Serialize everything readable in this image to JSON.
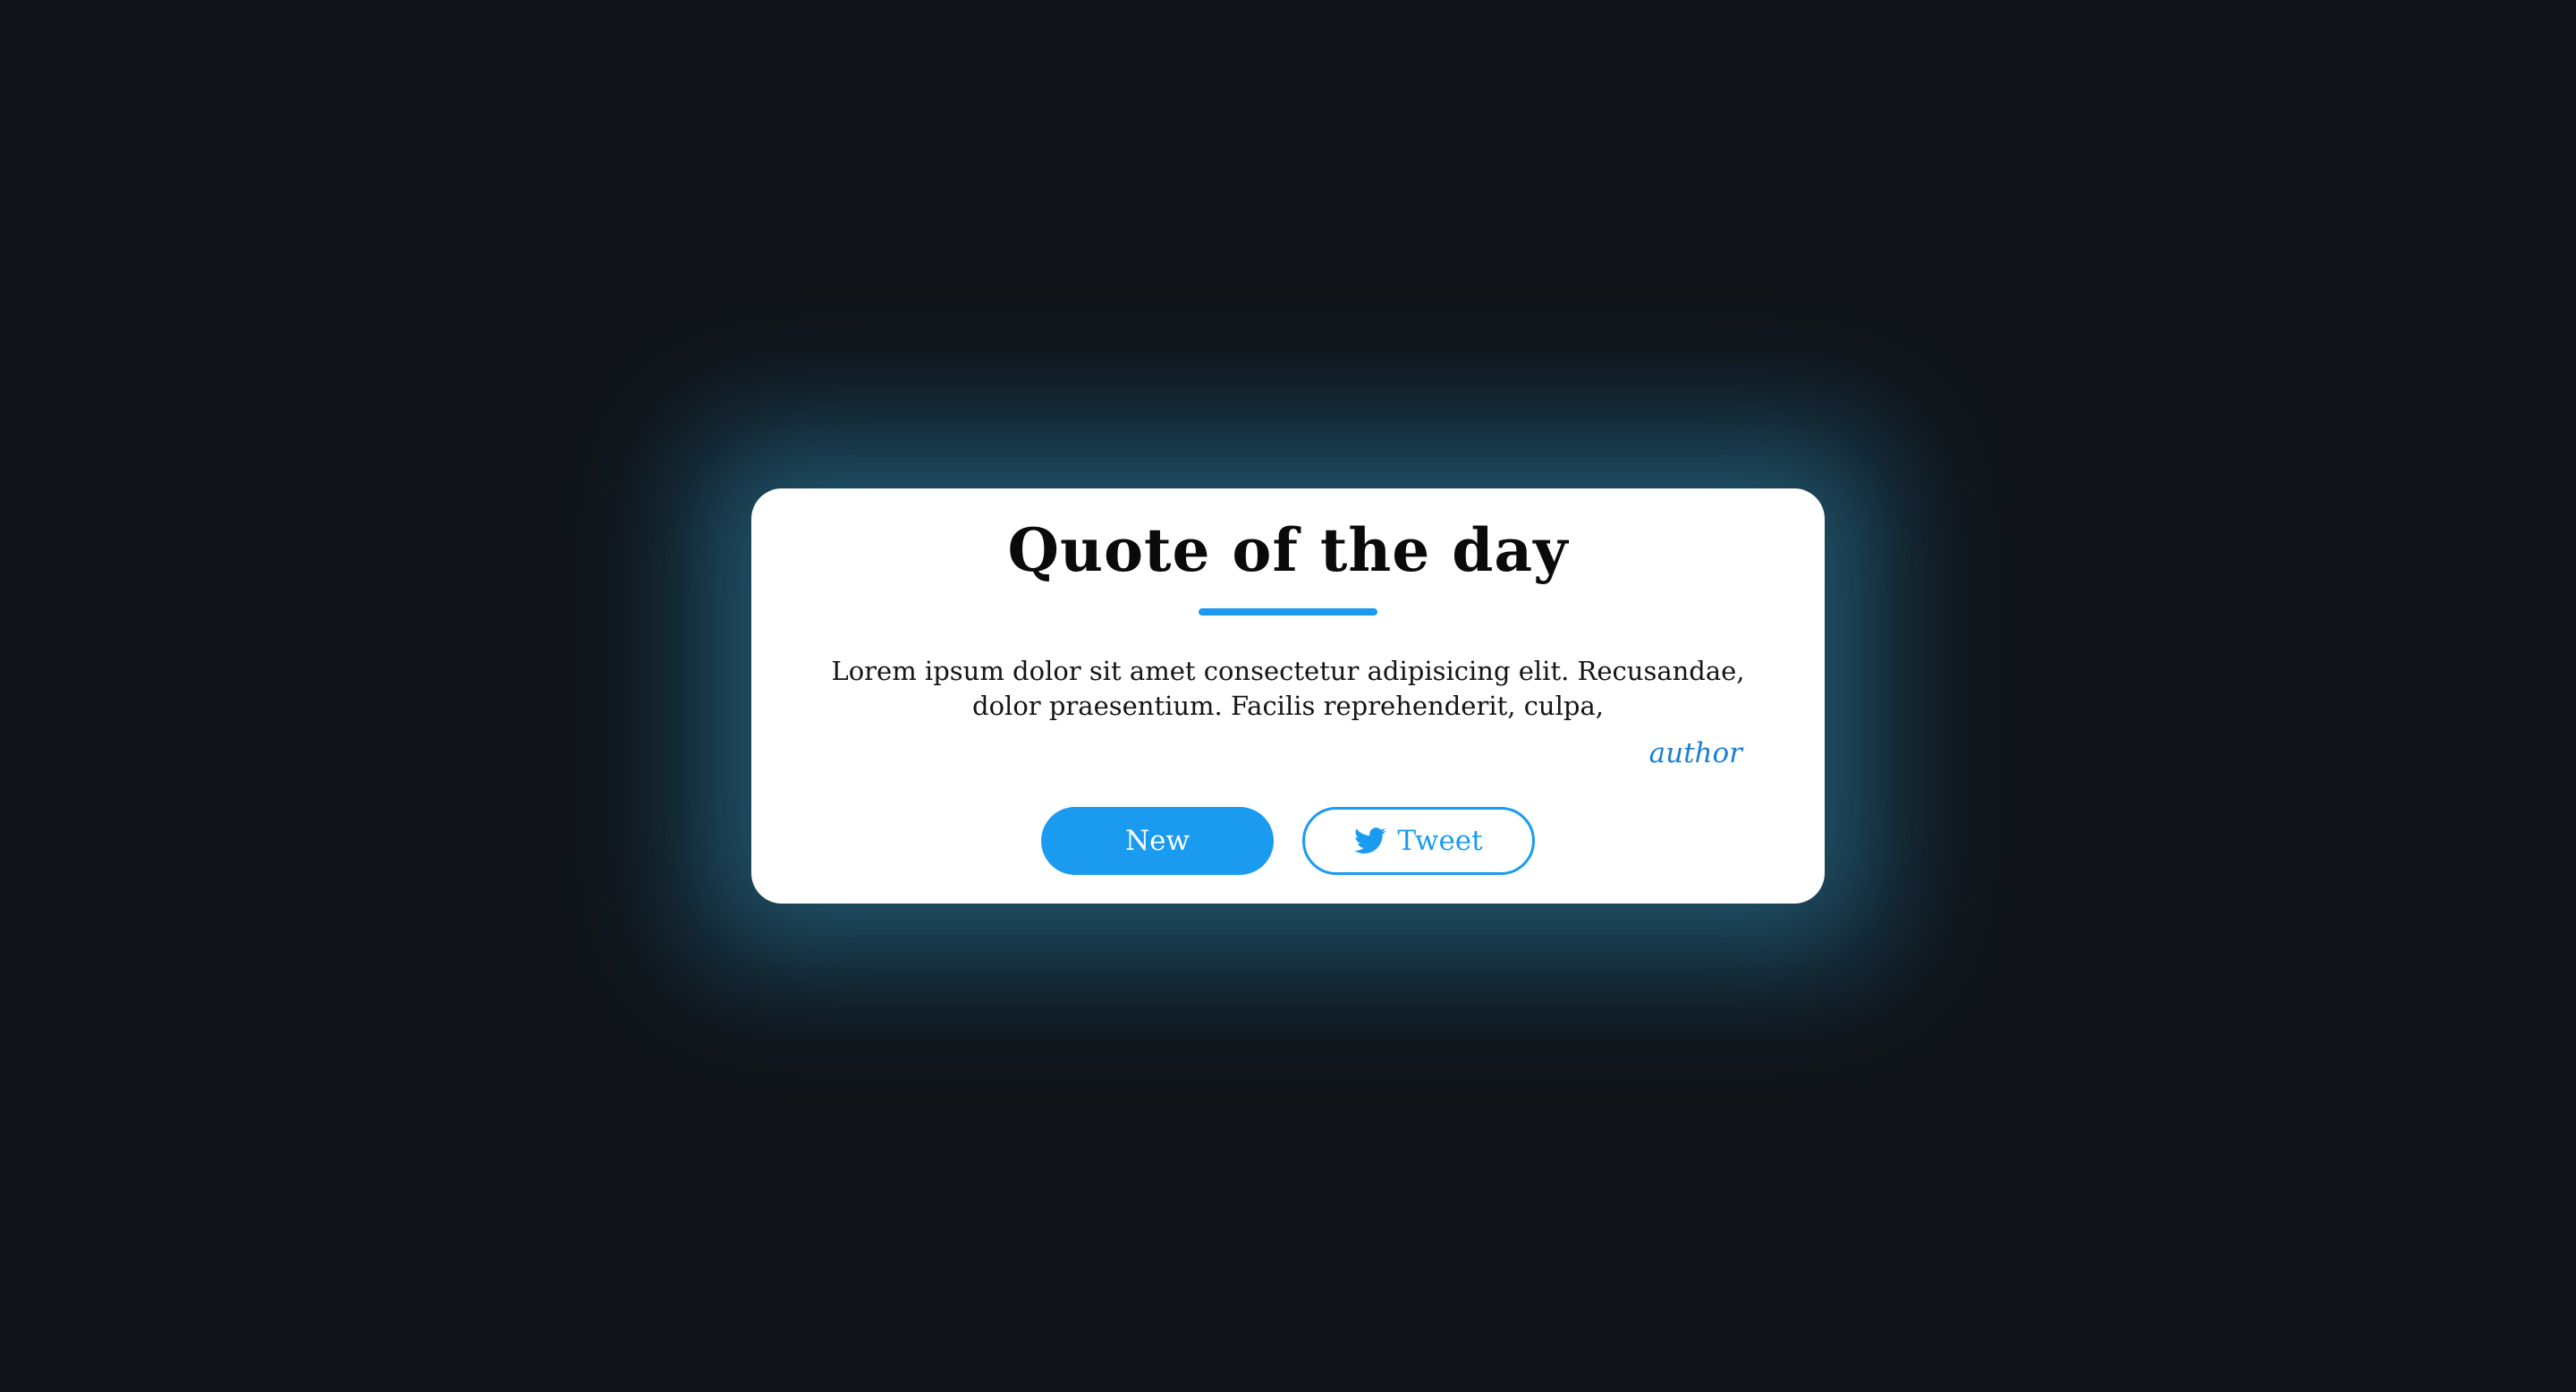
{
  "card": {
    "title": "Quote of the day",
    "quote": "Lorem ipsum dolor sit amet consectetur adipisicing elit. Recusandae, dolor praesentium. Facilis reprehenderit, culpa,",
    "author": "author"
  },
  "buttons": {
    "new_label": "New",
    "tweet_label": "Tweet",
    "tweet_icon": "twitter-bird-icon"
  },
  "colors": {
    "accent": "#1a9bf0",
    "author": "#1a7fd4",
    "background": "#111419",
    "card": "#ffffff",
    "glow": "#2a708c"
  }
}
